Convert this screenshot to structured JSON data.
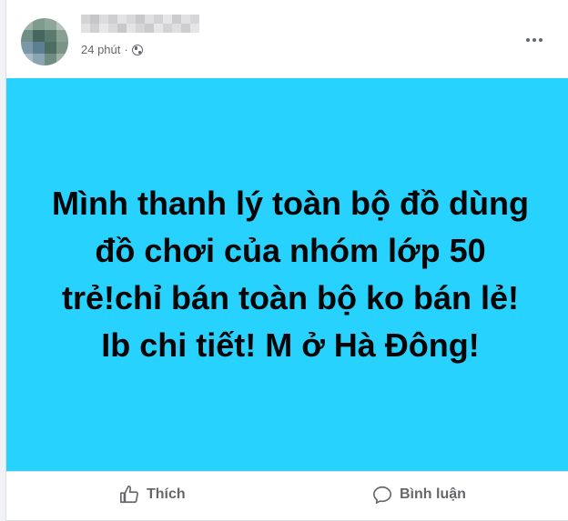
{
  "post": {
    "time": "24 phút",
    "separator": "·",
    "privacy_icon": "globe-icon",
    "more_icon": "more-options-icon",
    "text_lines": [
      "Mình thanh lý toàn bộ đồ dùng",
      "đồ chơi của nhóm lớp 50",
      "trẻ!chỉ bán toàn bộ ko bán lẻ!",
      "Ib chi tiết! M ở Hà Đông!"
    ],
    "background_color": "#27d2ff"
  },
  "actions": {
    "like_label": "Thích",
    "like_icon": "thumbs-up-icon",
    "comment_label": "Bình luận",
    "comment_icon": "comment-icon"
  }
}
